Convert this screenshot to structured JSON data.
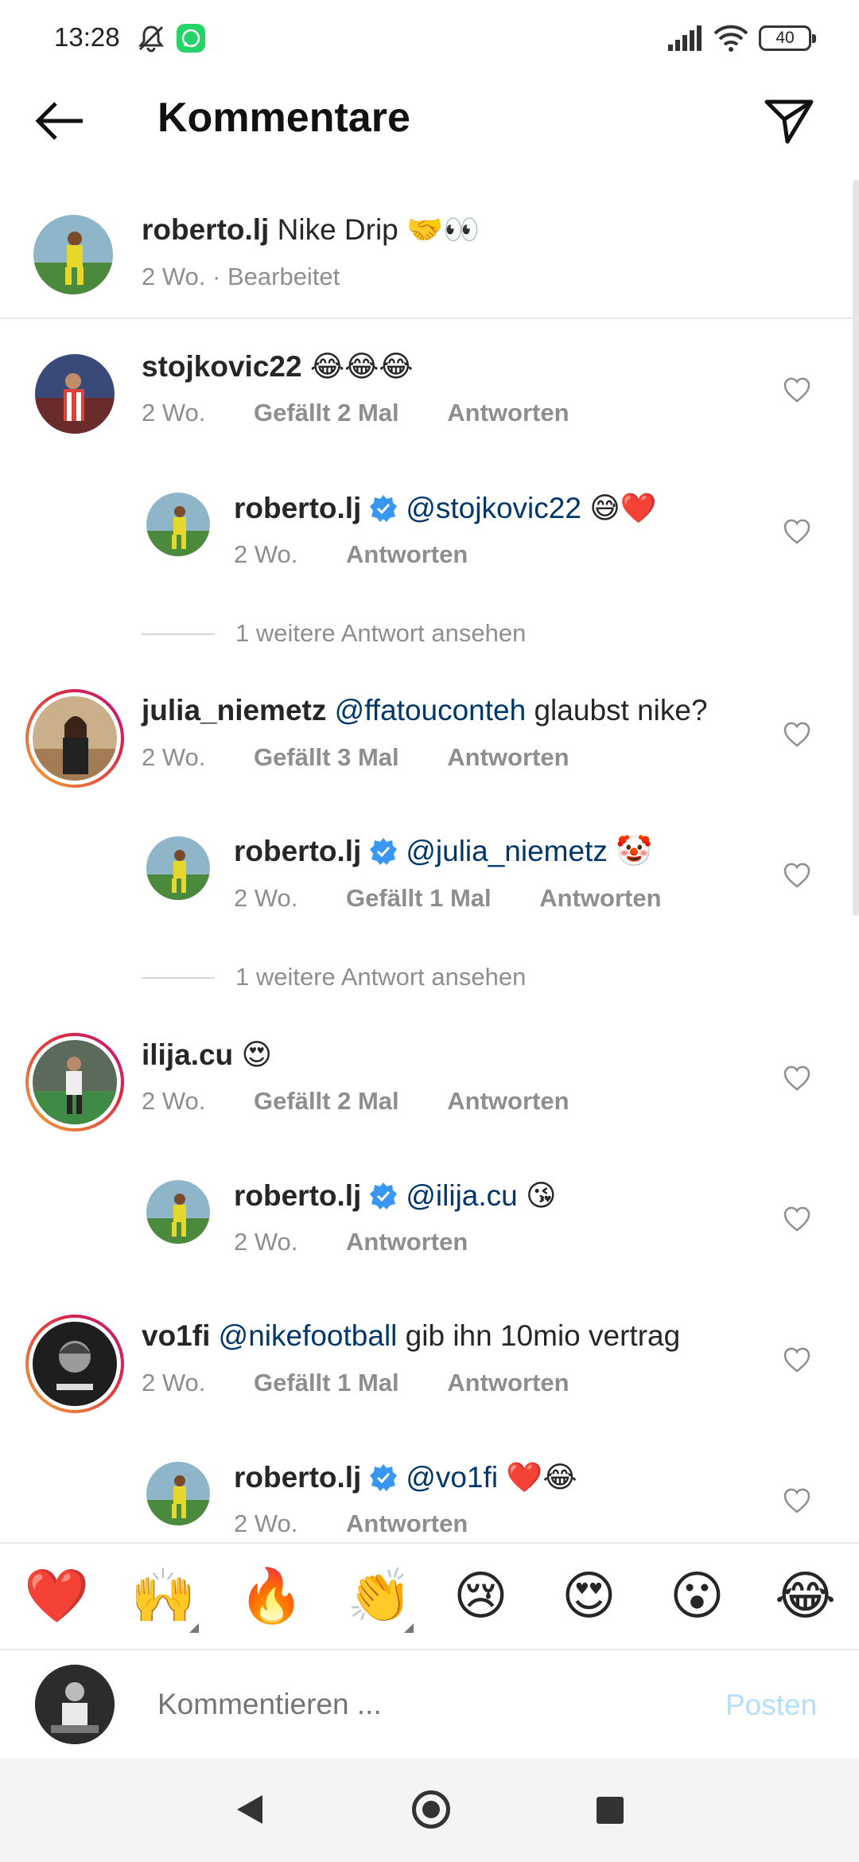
{
  "status_bar": {
    "time": "13:28",
    "battery": "40"
  },
  "header": {
    "title": "Kommentare"
  },
  "caption": {
    "username": "roberto.lj",
    "text": "Nike Drip 🤝👀",
    "time": "2 Wo.",
    "edited": "Bearbeitet"
  },
  "comments": [
    {
      "username": "stojkovic22",
      "text": "😂😂😂",
      "time": "2 Wo.",
      "likes": "Gefällt 2 Mal",
      "reply": "Antworten"
    },
    {
      "username": "roberto.lj",
      "mention": "@stojkovic22",
      "text": "😅❤️",
      "time": "2 Wo.",
      "reply": "Antworten"
    },
    {
      "more": "1 weitere Antwort ansehen"
    },
    {
      "username": "julia_niemetz",
      "mention": "@ffatouconteh",
      "text": "glaubst nike?",
      "time": "2 Wo.",
      "likes": "Gefällt 3 Mal",
      "reply": "Antworten"
    },
    {
      "username": "roberto.lj",
      "mention": "@julia_niemetz",
      "text": "🤡",
      "time": "2 Wo.",
      "likes": "Gefällt 1 Mal",
      "reply": "Antworten"
    },
    {
      "more": "1 weitere Antwort ansehen"
    },
    {
      "username": "ilija.cu",
      "text": "😍",
      "time": "2 Wo.",
      "likes": "Gefällt 2 Mal",
      "reply": "Antworten"
    },
    {
      "username": "roberto.lj",
      "mention": "@ilija.cu",
      "text": "😘",
      "time": "2 Wo.",
      "reply": "Antworten"
    },
    {
      "username": "vo1fi",
      "mention": "@nikefootball",
      "text": "gib ihn 10mio vertrag",
      "time": "2 Wo.",
      "likes": "Gefällt 1 Mal",
      "reply": "Antworten"
    },
    {
      "username": "roberto.lj",
      "mention": "@vo1fi",
      "text": "❤️😂",
      "time": "2 Wo.",
      "reply": "Antworten"
    }
  ],
  "emoji_bar": [
    "❤️",
    "🙌",
    "🔥",
    "👏",
    "😢",
    "😍",
    "😮",
    "😂"
  ],
  "compose": {
    "placeholder": "Kommentieren ...",
    "post_label": "Posten"
  },
  "colors": {
    "mention": "#00376b",
    "post_disabled": "#b2dffc",
    "meta": "#8e8e8e"
  }
}
